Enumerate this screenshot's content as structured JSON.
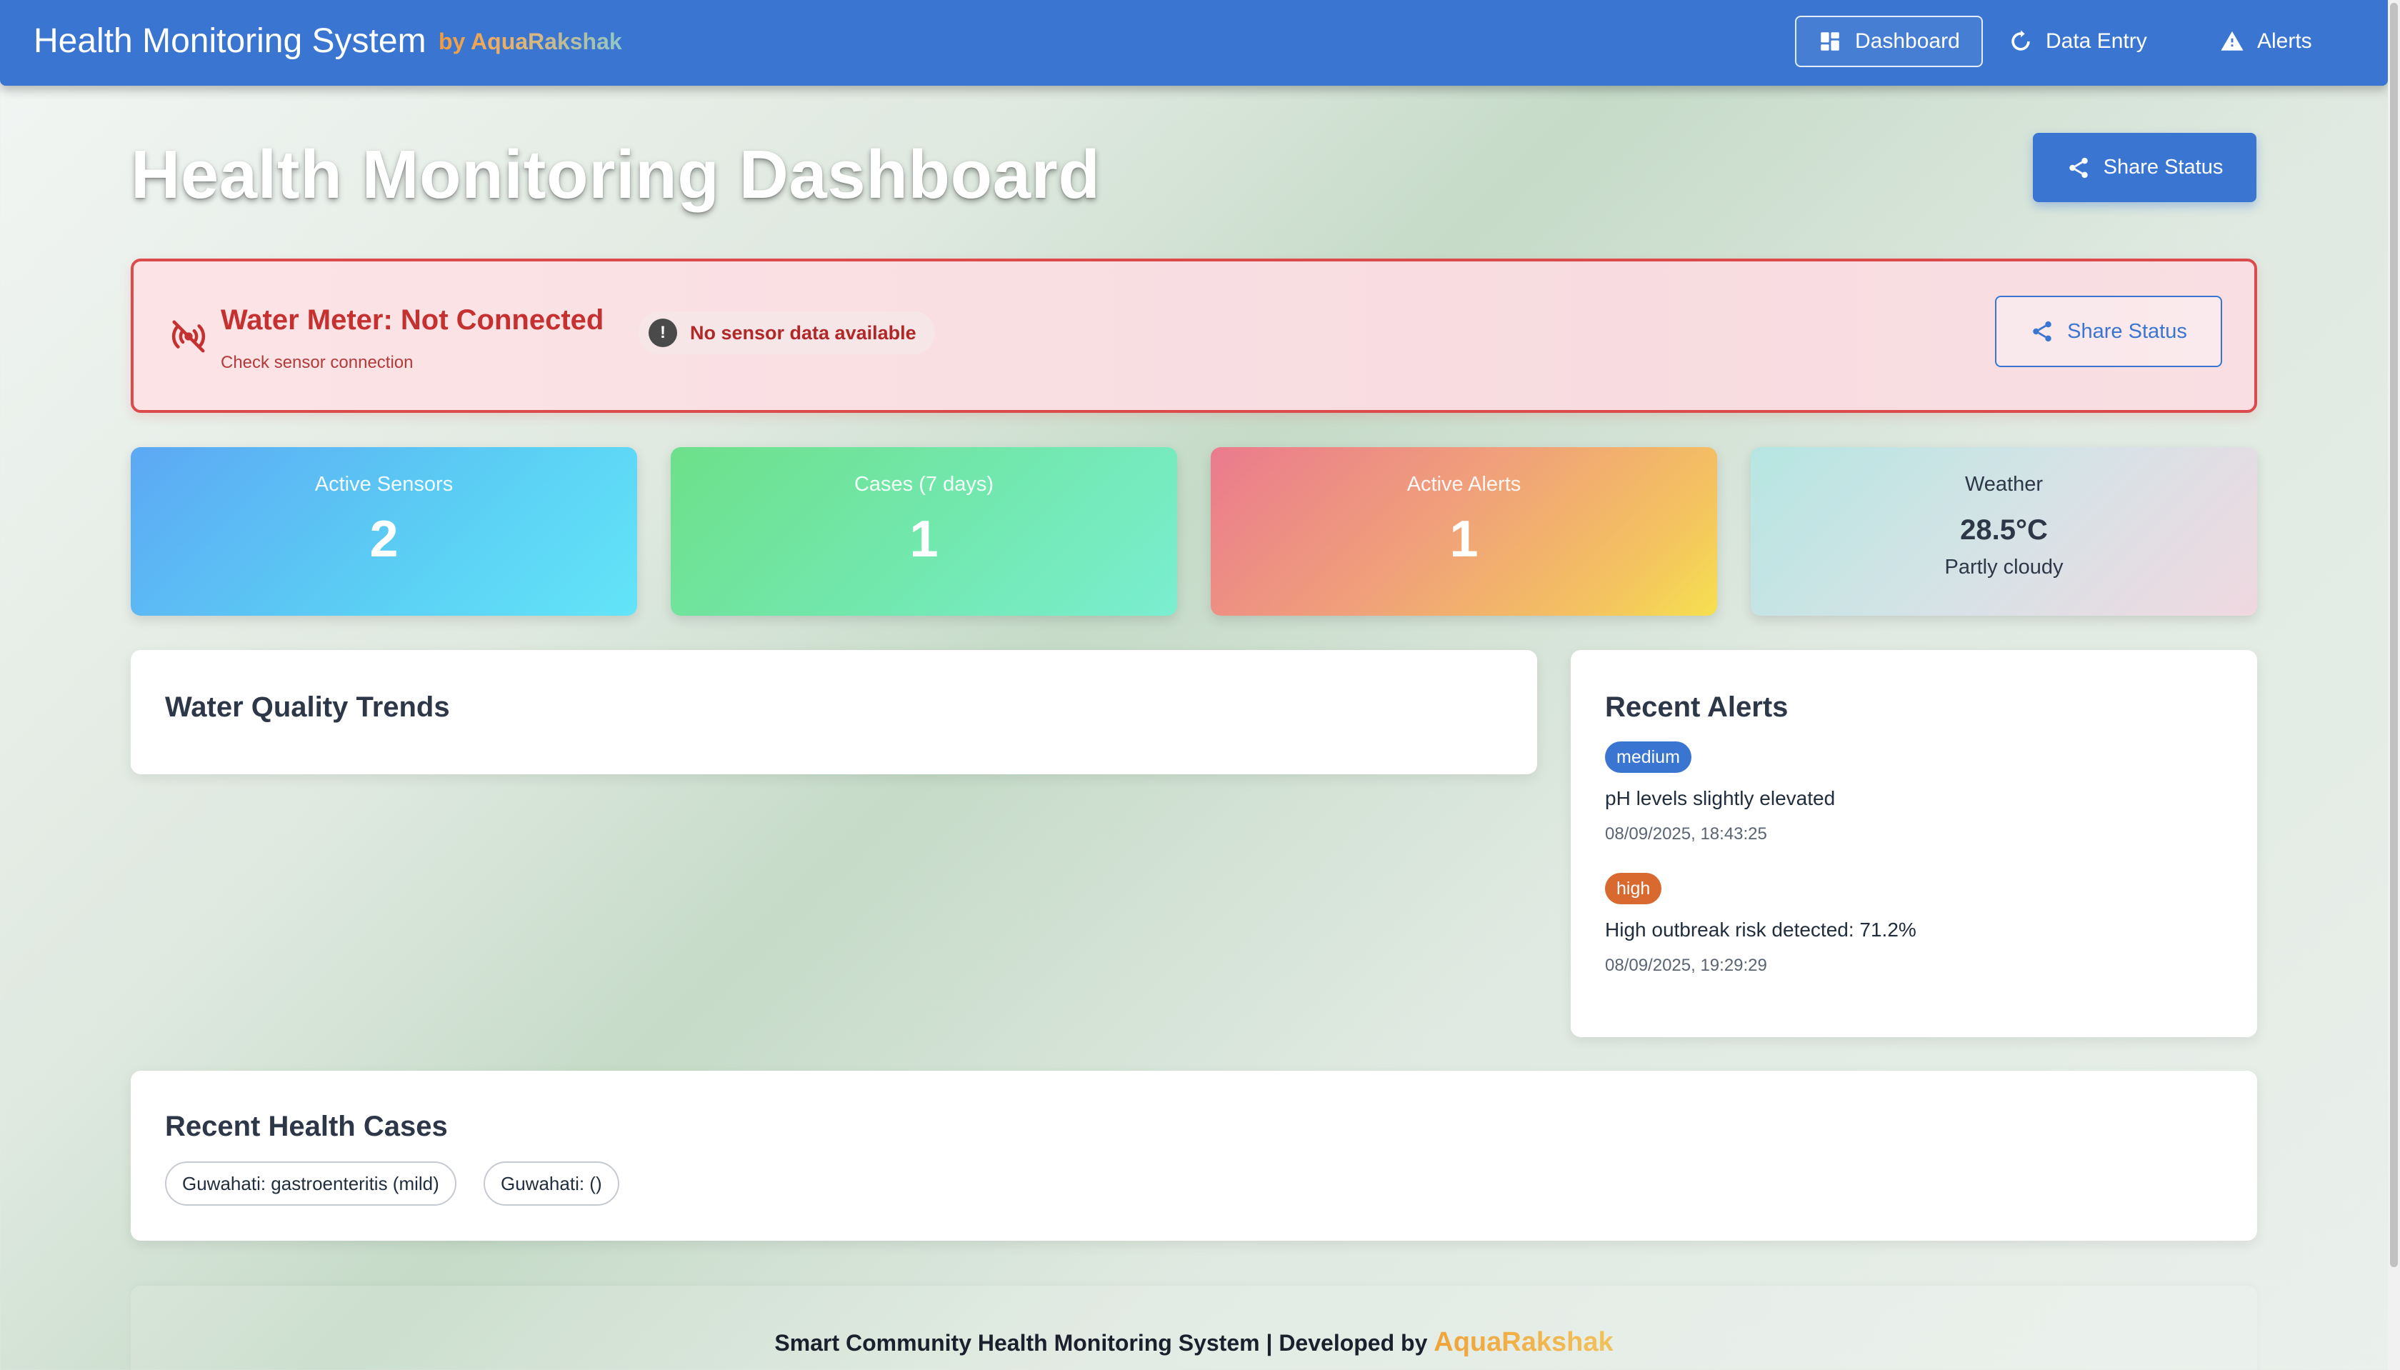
{
  "nav": {
    "brand": "Health Monitoring System",
    "brand_sub": "by AquaRakshak",
    "items": [
      {
        "label": "Dashboard",
        "icon": "dashboard-icon",
        "active": true
      },
      {
        "label": "Data Entry",
        "icon": "refresh-icon",
        "active": false
      },
      {
        "label": "Alerts",
        "icon": "warning-icon",
        "active": false
      }
    ]
  },
  "header": {
    "title": "Health Monitoring Dashboard",
    "share_label": "Share Status"
  },
  "status": {
    "title": "Water Meter: Not Connected",
    "subtitle": "Check sensor connection",
    "chip": "No sensor data available",
    "share_label": "Share Status",
    "icon": "signal-off-icon"
  },
  "stats": {
    "sensors": {
      "label": "Active Sensors",
      "value": "2"
    },
    "cases": {
      "label": "Cases (7 days)",
      "value": "1"
    },
    "alerts": {
      "label": "Active Alerts",
      "value": "1"
    },
    "weather": {
      "label": "Weather",
      "temp": "28.5°C",
      "desc": "Partly cloudy"
    }
  },
  "trends": {
    "title": "Water Quality Trends"
  },
  "recent_alerts": {
    "title": "Recent Alerts",
    "items": [
      {
        "severity": "medium",
        "message": "pH levels slightly elevated",
        "time": "08/09/2025, 18:43:25"
      },
      {
        "severity": "high",
        "message": "High outbreak risk detected: 71.2%",
        "time": "08/09/2025, 19:29:29"
      }
    ]
  },
  "recent_cases": {
    "title": "Recent Health Cases",
    "items": [
      "Guwahati: gastroenteritis (mild)",
      "Guwahati: ()"
    ]
  },
  "footer": {
    "text": "Smart Community Health Monitoring System | Developed by",
    "brand": "AquaRakshak"
  },
  "colors": {
    "primary": "#3a76d1",
    "danger": "#c53030",
    "badge_medium": "#3a76d1",
    "badge_high": "#d8692f"
  }
}
